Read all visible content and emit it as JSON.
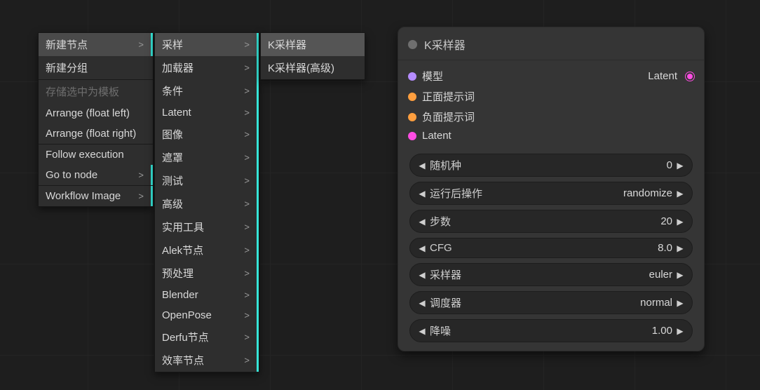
{
  "menu1": {
    "items": [
      {
        "label": "新建节点",
        "submenu": true,
        "hover": true
      },
      {
        "label": "新建分组"
      },
      {
        "sep": true
      },
      {
        "label": "存储选中为模板",
        "disabled": true
      },
      {
        "label": "Arrange (float left)"
      },
      {
        "label": "Arrange (float right)"
      },
      {
        "sep": true
      },
      {
        "label": "Follow execution"
      },
      {
        "label": "Go to node",
        "submenu": true
      },
      {
        "sep": true
      },
      {
        "label": "Workflow Image",
        "submenu": true
      }
    ]
  },
  "menu2": {
    "items": [
      {
        "label": "采样",
        "submenu": true,
        "hover": true
      },
      {
        "label": "加载器",
        "submenu": true
      },
      {
        "label": "条件",
        "submenu": true
      },
      {
        "label": "Latent",
        "submenu": true
      },
      {
        "label": "图像",
        "submenu": true
      },
      {
        "label": "遮罩",
        "submenu": true
      },
      {
        "label": "测试",
        "submenu": true
      },
      {
        "label": "高级",
        "submenu": true
      },
      {
        "label": "实用工具",
        "submenu": true
      },
      {
        "label": "Alek节点",
        "submenu": true
      },
      {
        "label": "预处理",
        "submenu": true
      },
      {
        "label": "Blender",
        "submenu": true
      },
      {
        "label": "OpenPose",
        "submenu": true
      },
      {
        "label": "Derfu节点",
        "submenu": true
      },
      {
        "label": "效率节点",
        "submenu": true
      }
    ]
  },
  "menu3": {
    "items": [
      {
        "label": "K采样器",
        "hover": true
      },
      {
        "label": "K采样器(高级)"
      }
    ]
  },
  "node": {
    "title": "K采样器",
    "inputs": [
      {
        "label": "模型",
        "color": "purple"
      },
      {
        "label": "正面提示词",
        "color": "orange"
      },
      {
        "label": "负面提示词",
        "color": "orange"
      },
      {
        "label": "Latent",
        "color": "pink"
      }
    ],
    "outputs": [
      {
        "label": "Latent",
        "color": "pink"
      }
    ],
    "params": [
      {
        "label": "随机种",
        "value": "0"
      },
      {
        "label": "运行后操作",
        "value": "randomize"
      },
      {
        "label": "步数",
        "value": "20"
      },
      {
        "label": "CFG",
        "value": "8.0"
      },
      {
        "label": "采样器",
        "value": "euler"
      },
      {
        "label": "调度器",
        "value": "normal"
      },
      {
        "label": "降噪",
        "value": "1.00"
      }
    ]
  }
}
